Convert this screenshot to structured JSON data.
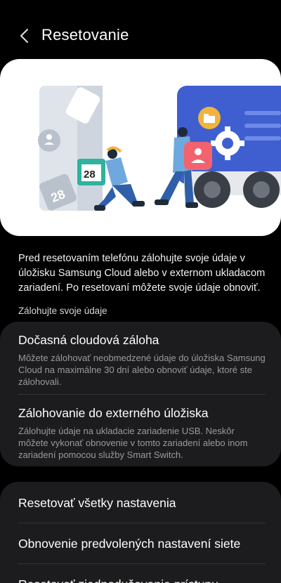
{
  "header": {
    "title": "Resetovanie",
    "back_icon": "chevron-left-icon"
  },
  "illustration": {
    "calendar_number": "28",
    "calendar_number_faded": "28",
    "colors": {
      "blue": "#3f5fd1",
      "orange": "#f2b33d",
      "light_blue": "#6fa8dc",
      "pink": "#f2636e",
      "teal": "#2db39e"
    }
  },
  "intro_text": "Pred resetovaním telefónu zálohujte svoje údaje v úložisku Samsung Cloud alebo v externom ukladacom zariadení. Po resetovaní môžete svoje údaje obnoviť.",
  "section_label": "Zálohujte svoje údaje",
  "backup_items": [
    {
      "title": "Dočasná cloudová záloha",
      "description": "Môžete zálohovať neobmedzené údaje do úložiska Samsung Cloud na maximálne 30 dní alebo obnoviť údaje, ktoré ste zálohovali."
    },
    {
      "title": "Zálohovanie do externého úložiska",
      "description": "Zálohujte údaje na ukladacie zariadenie USB. Neskôr môžete vykonať obnovenie v tomto zariadení alebo inom zariadení pomocou služby Smart Switch."
    }
  ],
  "reset_items": [
    {
      "label": "Resetovať všetky nastavenia"
    },
    {
      "label": "Obnovenie predvolených nastavení siete"
    },
    {
      "label": "Resetovať zjednodušovanie prístupu"
    }
  ]
}
